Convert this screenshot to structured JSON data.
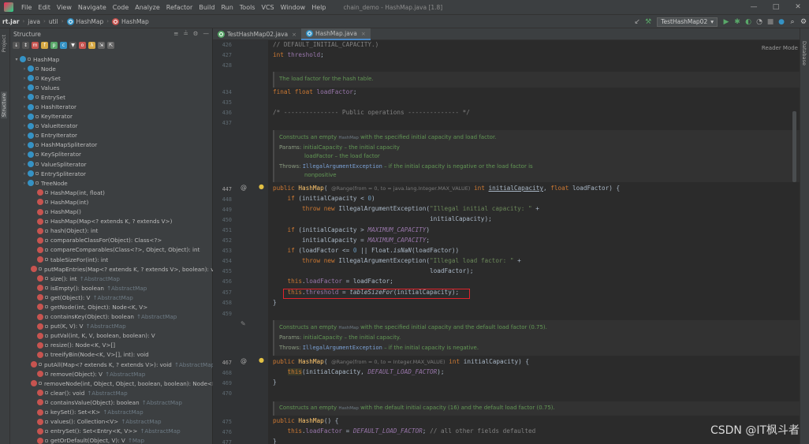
{
  "menubar": {
    "items": [
      "File",
      "Edit",
      "View",
      "Navigate",
      "Code",
      "Analyze",
      "Refactor",
      "Build",
      "Run",
      "Tools",
      "VCS",
      "Window",
      "Help"
    ],
    "title": "chain_demo - HashMap.java [1.8]",
    "controls": {
      "minimize": "—",
      "maximize": "□",
      "close": "✕"
    }
  },
  "navbar": {
    "crumbs": [
      "rt.jar",
      "java",
      "util",
      "HashMap",
      "HashMap"
    ],
    "run_config": "TestHashMap02",
    "icons": [
      "arrow-left-icon",
      "hammer-icon",
      "run-icon",
      "debug-icon",
      "coverage-icon",
      "profile-icon",
      "stop-icon",
      "avatar-icon",
      "search-icon",
      "settings-icon"
    ]
  },
  "left_strip": {
    "tabs": [
      "Project",
      "Structure"
    ]
  },
  "structure": {
    "title": "Structure",
    "rows": [
      {
        "kind": "root",
        "arrow": "▾",
        "icon": "c",
        "name": "HashMap",
        "inh": ""
      },
      {
        "kind": "class",
        "arrow": "›",
        "icon": "c",
        "name": "Node",
        "inh": ""
      },
      {
        "kind": "class",
        "arrow": "›",
        "icon": "c",
        "name": "KeySet",
        "inh": ""
      },
      {
        "kind": "class",
        "arrow": "›",
        "icon": "c",
        "name": "Values",
        "inh": ""
      },
      {
        "kind": "class",
        "arrow": "›",
        "icon": "c",
        "name": "EntrySet",
        "inh": ""
      },
      {
        "kind": "class",
        "arrow": "›",
        "icon": "c",
        "name": "HashIterator",
        "inh": ""
      },
      {
        "kind": "class",
        "arrow": "›",
        "icon": "c",
        "name": "KeyIterator",
        "inh": ""
      },
      {
        "kind": "class",
        "arrow": "›",
        "icon": "c",
        "name": "ValueIterator",
        "inh": ""
      },
      {
        "kind": "class",
        "arrow": "›",
        "icon": "c",
        "name": "EntryIterator",
        "inh": ""
      },
      {
        "kind": "class",
        "arrow": "›",
        "icon": "c",
        "name": "HashMapSpliterator",
        "inh": ""
      },
      {
        "kind": "class",
        "arrow": "›",
        "icon": "c",
        "name": "KeySpliterator",
        "inh": ""
      },
      {
        "kind": "class",
        "arrow": "›",
        "icon": "c",
        "name": "ValueSpliterator",
        "inh": ""
      },
      {
        "kind": "class",
        "arrow": "›",
        "icon": "c",
        "name": "EntrySpliterator",
        "inh": ""
      },
      {
        "kind": "class",
        "arrow": "›",
        "icon": "c",
        "name": "TreeNode",
        "inh": ""
      },
      {
        "kind": "method",
        "arrow": "",
        "icon": "m",
        "name": "HashMap(int, float)",
        "inh": ""
      },
      {
        "kind": "method",
        "arrow": "",
        "icon": "m",
        "name": "HashMap(int)",
        "inh": ""
      },
      {
        "kind": "method",
        "arrow": "",
        "icon": "m",
        "name": "HashMap()",
        "inh": ""
      },
      {
        "kind": "method",
        "arrow": "",
        "icon": "m",
        "name": "HashMap(Map<? extends K, ? extends V>)",
        "inh": ""
      },
      {
        "kind": "method",
        "arrow": "",
        "icon": "m",
        "name": "hash(Object): int",
        "inh": ""
      },
      {
        "kind": "method",
        "arrow": "",
        "icon": "m",
        "name": "comparableClassFor(Object): Class<?>",
        "inh": ""
      },
      {
        "kind": "method",
        "arrow": "",
        "icon": "m",
        "name": "compareComparables(Class<?>, Object, Object): int",
        "inh": ""
      },
      {
        "kind": "method",
        "arrow": "",
        "icon": "m",
        "name": "tableSizeFor(int): int",
        "inh": ""
      },
      {
        "kind": "method",
        "arrow": "",
        "icon": "m",
        "name": "putMapEntries(Map<? extends K, ? extends V>, boolean): vo",
        "inh": ""
      },
      {
        "kind": "method",
        "arrow": "",
        "icon": "m",
        "name": "size(): int",
        "inh": "↑AbstractMap"
      },
      {
        "kind": "method",
        "arrow": "",
        "icon": "m",
        "name": "isEmpty(): boolean",
        "inh": "↑AbstractMap"
      },
      {
        "kind": "method",
        "arrow": "",
        "icon": "m",
        "name": "get(Object): V",
        "inh": "↑AbstractMap"
      },
      {
        "kind": "method",
        "arrow": "",
        "icon": "m",
        "name": "getNode(int, Object): Node<K, V>",
        "inh": ""
      },
      {
        "kind": "method",
        "arrow": "",
        "icon": "m",
        "name": "containsKey(Object): boolean",
        "inh": "↑AbstractMap"
      },
      {
        "kind": "method",
        "arrow": "",
        "icon": "m",
        "name": "put(K, V): V",
        "inh": "↑AbstractMap"
      },
      {
        "kind": "method",
        "arrow": "",
        "icon": "m",
        "name": "putVal(int, K, V, boolean, boolean): V",
        "inh": ""
      },
      {
        "kind": "method",
        "arrow": "",
        "icon": "m",
        "name": "resize(): Node<K, V>[]",
        "inh": ""
      },
      {
        "kind": "method",
        "arrow": "",
        "icon": "m",
        "name": "treeifyBin(Node<K, V>[], int): void",
        "inh": ""
      },
      {
        "kind": "method",
        "arrow": "",
        "icon": "m",
        "name": "putAll(Map<? extends K, ? extends V>): void",
        "inh": "↑AbstractMap"
      },
      {
        "kind": "method",
        "arrow": "",
        "icon": "m",
        "name": "remove(Object): V",
        "inh": "↑AbstractMap"
      },
      {
        "kind": "method",
        "arrow": "",
        "icon": "m",
        "name": "removeNode(int, Object, Object, boolean, boolean): Node<K",
        "inh": ""
      },
      {
        "kind": "method",
        "arrow": "",
        "icon": "m",
        "name": "clear(): void",
        "inh": "↑AbstractMap"
      },
      {
        "kind": "method",
        "arrow": "",
        "icon": "m",
        "name": "containsValue(Object): boolean",
        "inh": "↑AbstractMap"
      },
      {
        "kind": "method",
        "arrow": "",
        "icon": "m",
        "name": "keySet(): Set<K>",
        "inh": "↑AbstractMap"
      },
      {
        "kind": "method",
        "arrow": "",
        "icon": "m",
        "name": "values(): Collection<V>",
        "inh": "↑AbstractMap"
      },
      {
        "kind": "method",
        "arrow": "",
        "icon": "m",
        "name": "entrySet(): Set<Entry<K, V>>",
        "inh": "↑AbstractMap"
      },
      {
        "kind": "method",
        "arrow": "",
        "icon": "m",
        "name": "getOrDefault(Object, V): V",
        "inh": "↑Map"
      }
    ]
  },
  "tabs": [
    {
      "label": "TestHashMap02.java",
      "active": false
    },
    {
      "label": "HashMap.java",
      "active": true
    }
  ],
  "editor": {
    "reader_mode": "Reader Mode",
    "line_numbers": {
      "l426": "426",
      "l427": "427",
      "l428": "428",
      "l434": "434",
      "l435": "435",
      "l436": "436",
      "l437": "437",
      "l447": "447",
      "l448": "448",
      "l449": "449",
      "l450": "450",
      "l451": "451",
      "l452": "452",
      "l453": "453",
      "l454": "454",
      "l455": "455",
      "l456": "456",
      "l457": "457",
      "l458": "458",
      "l459": "459",
      "l467": "467",
      "l468": "468",
      "l469": "469",
      "l470": "470",
      "l475": "475",
      "l476": "476",
      "l477": "477"
    },
    "code": {
      "c426": "// DEFAULT_INITIAL_CAPACITY.)",
      "doc_loadfactor": "The load factor for the hash table.",
      "c437": "/* --------------- Public operations -------------- */",
      "doc1_line1a": "Constructs an empty ",
      "doc1_line1b": "HashMap",
      "doc1_line1c": " with the specified initial capacity and load factor.",
      "doc1_params": "Params: ",
      "doc1_p1": "initialCapacity – the initial capacity",
      "doc1_p2": "loadFactor – the load factor",
      "doc1_throws": "Throws: ",
      "doc1_exc": "IllegalArgumentException",
      "doc1_exc_rest": " – if the initial capacity is negative or the load factor is",
      "doc1_exc_rest2": "nonpositive",
      "hint_range": "@Range(from = 0, to = java.lang.Integer.MAX_VALUE)",
      "hint_range2": "@Range(from = 0, to = Integer.MAX_VALUE)",
      "str_illegal_cap": "\"Illegal initial capacity: \"",
      "str_illegal_lf": "\"Illegal load factor: \"",
      "doc2_a": "Constructs an empty ",
      "doc2_b": "HashMap",
      "doc2_c": " with the specified initial capacity and the default load factor (0.75).",
      "doc2_params": "Params: ",
      "doc2_p1": "initialCapacity – the initial capacity.",
      "doc2_throws": "Throws: ",
      "doc2_exc": "IllegalArgumentException",
      "doc2_exc_rest": " – if the initial capacity is negative.",
      "doc3_a": "Constructs an empty ",
      "doc3_b": "HashMap",
      "doc3_c": " with the default initial capacity (16) and the default load factor (0.75).",
      "c476_comment": "// all other fields defaulted"
    }
  },
  "right_strip": {
    "tab": "Database"
  },
  "watermark": "CSDN @IT枫斗者",
  "colors": {
    "highlight": "#e0242c",
    "accent": "#4a88c7"
  }
}
